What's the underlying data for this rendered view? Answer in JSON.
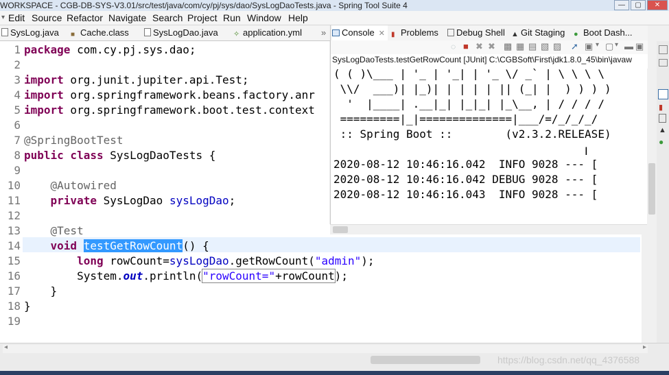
{
  "window": {
    "title": "WORKSPACE - CGB-DB-SYS-V3.01/src/test/java/com/cy/pj/sys/dao/SysLogDaoTests.java - Spring Tool Suite 4"
  },
  "menu": [
    "Edit",
    "Source",
    "Refactor",
    "Navigate",
    "Search",
    "Project",
    "Run",
    "Window",
    "Help"
  ],
  "editor_tabs": [
    {
      "label": "SysLog.java"
    },
    {
      "label": "Cache.class"
    },
    {
      "label": "SysLogDao.java"
    },
    {
      "label": "application.yml"
    }
  ],
  "console_tabs": [
    {
      "label": "Console"
    },
    {
      "label": "Problems"
    },
    {
      "label": "Debug Shell"
    },
    {
      "label": "Git Staging"
    },
    {
      "label": "Boot Dash..."
    }
  ],
  "console": {
    "launch_path": "SysLogDaoTests.testGetRowCount [JUnit] C:\\CGBSoft\\First\\jdk1.8.0_45\\bin\\javaw",
    "lines": [
      "( ( )\\___ | '_ | '_| | '_ \\/ _` | \\ \\ \\ \\",
      " \\\\/  ___)| |_)| | | | | || (_| |  ) ) ) )",
      "  '  |____| .__|_| |_|_| |_\\__, | / / / /",
      " =========|_|==============|___/=/_/_/_/",
      " :: Spring Boot ::        (v2.3.2.RELEASE)",
      "",
      "2020-08-12 10:46:16.042  INFO 9028 --- [",
      "2020-08-12 10:46:16.042 DEBUG 9028 --- [",
      "2020-08-12 10:46:16.043  INFO 9028 --- ["
    ]
  },
  "code": {
    "line_numbers": [
      "1",
      "2",
      "3",
      "4",
      "5",
      "6",
      "7",
      "8",
      "9",
      "10",
      "11",
      "12",
      "13",
      "14",
      "15",
      "16",
      "17",
      "18",
      "19"
    ],
    "l1_kw": "package",
    "l1_rest": " com.cy.pj.sys.dao;",
    "l3_kw": "import",
    "l3_rest": " org.junit.jupiter.api.Test;",
    "l4_kw": "import",
    "l4_rest": " org.springframework.beans.factory.anr",
    "l5_kw": "import",
    "l5_rest": " org.springframework.boot.test.context",
    "l7_ann": "@SpringBootTest",
    "l8_kw": "public class",
    "l8_rest": " SysLogDaoTests {",
    "l10_ann": "    @Autowired",
    "l11_kw": "    private",
    "l11_rest": " SysLogDao ",
    "l11_fld": "sysLogDao",
    "l11_end": ";",
    "l13_ann": "    @Test",
    "l14_kw": "    void",
    "l14_sp": " ",
    "l14_sel": "testGetRowCount",
    "l14_end": "() {",
    "l15_kw": "        long",
    "l15_a": " rowCount=",
    "l15_fld": "sysLogDao",
    "l15_b": ".getRowCount(",
    "l15_str": "\"admin\"",
    "l15_c": ");",
    "l16_a": "        System.",
    "l16_it": "out",
    "l16_b": ".println(",
    "l16_str": "\"rowCount=\"",
    "l16_c": "+rowCount",
    "l16_d": ");",
    "l17": "    }",
    "l18": "}"
  },
  "watermark": "https://blog.csdn.net/qq_4376588"
}
